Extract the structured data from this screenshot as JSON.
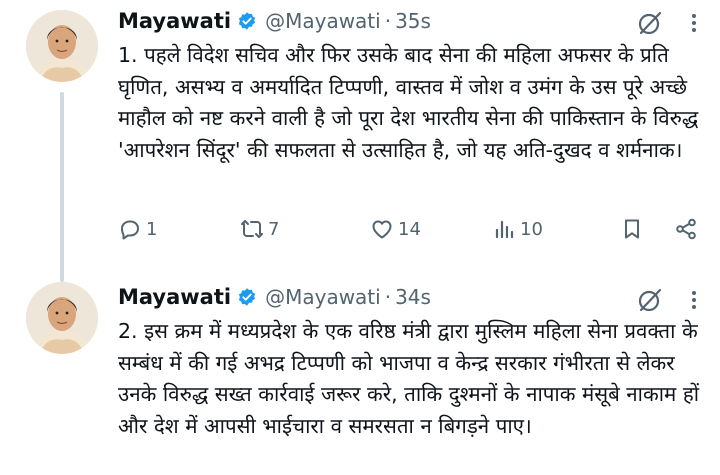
{
  "tweets": [
    {
      "author_name": "Mayawati",
      "handle": "@Mayawati",
      "separator": "·",
      "time": "35s",
      "text": "1. पहले विदेश सचिव और फिर उसके बाद सेना की महिला अफसर के प्रति घृणित, असभ्य व अमर्यादित टिप्पणी, वास्तव में जोश व उमंग के उस पूरे अच्छे माहौल को नष्ट करने वाली है जो पूरा देश भारतीय सेना की पाकिस्तान के विरुद्ध 'आपरेशन सिंदूर' की सफलता से उत्साहित है, जो यह अति-दुखद व शर्मनाक।",
      "replies": "1",
      "reposts": "7",
      "likes": "14",
      "views": "10"
    },
    {
      "author_name": "Mayawati",
      "handle": "@Mayawati",
      "separator": "·",
      "time": "34s",
      "text": "2. इस क्रम में मध्यप्रदेश के एक वरिष्ठ मंत्री द्वारा मुस्लिम महिला सेना प्रवक्ता के सम्बंध में की गई अभद्र टिप्पणी को भाजपा व केन्द्र सरकार गंभीरता से लेकर उनके विरुद्ध सख्त कार्रवाई जरूर करे, ताकि दुश्मनों के नापाक मंसूबे नाकाम हों और देश में आपसी भाईचारा व समरसता न बिगड़ने पाए।"
    }
  ],
  "icons": [
    "verified-badge-icon",
    "grok-icon",
    "more-icon",
    "reply-icon",
    "repost-icon",
    "like-icon",
    "views-icon",
    "bookmark-icon",
    "share-icon"
  ],
  "colors": {
    "verified": "#1d9bf0",
    "secondary_text": "#536471",
    "thread_line": "#cfd9de"
  }
}
